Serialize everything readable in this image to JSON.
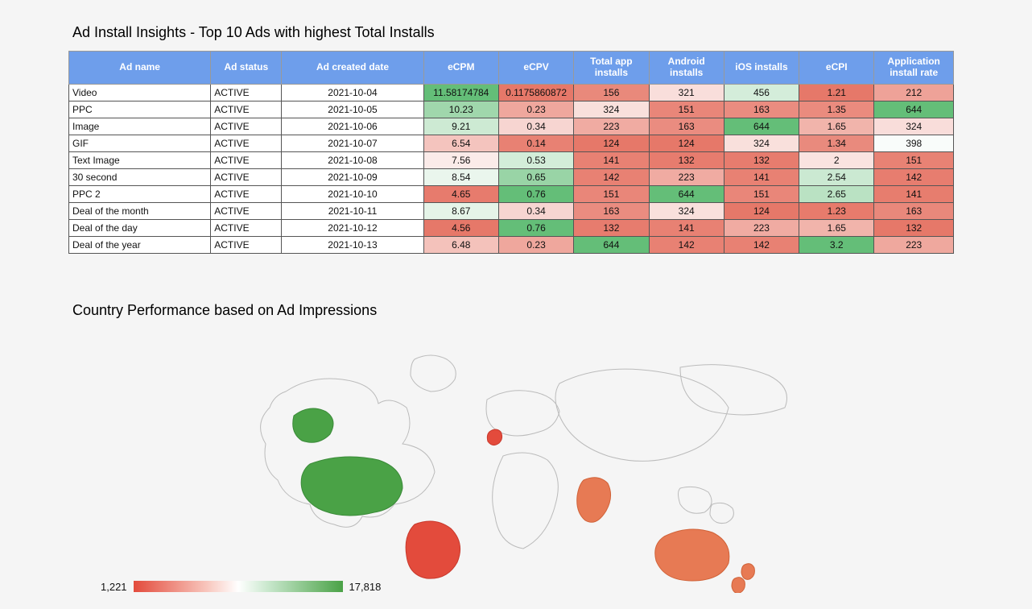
{
  "title1": "Ad Install Insights - Top 10 Ads with highest Total Installs",
  "title2": "Country Performance based on Ad Impressions",
  "legend_min": "1,221",
  "legend_max": "17,818",
  "heatmap_cols": [
    "ecpm",
    "ecpv",
    "total_app",
    "android",
    "ios",
    "ecpi",
    "air"
  ],
  "headers": {
    "name": "Ad name",
    "status": "Ad status",
    "date": "Ad created date",
    "ecpm": "eCPM",
    "ecpv": "eCPV",
    "total_app": "Total app installs",
    "android": "Android installs",
    "ios": "iOS installs",
    "ecpi": "eCPI",
    "air": "Application install rate"
  },
  "rows": [
    {
      "name": "Video",
      "status": "ACTIVE",
      "date": "2021-10-04",
      "ecpm": "11.58174784",
      "ecpv": "0.1175860872",
      "total_app": "156",
      "android": "321",
      "ios": "456",
      "ecpi": "1.21",
      "air": "212"
    },
    {
      "name": "PPC",
      "status": "ACTIVE",
      "date": "2021-10-05",
      "ecpm": "10.23",
      "ecpv": "0.23",
      "total_app": "324",
      "android": "151",
      "ios": "163",
      "ecpi": "1.35",
      "air": "644"
    },
    {
      "name": "Image",
      "status": "ACTIVE",
      "date": "2021-10-06",
      "ecpm": "9.21",
      "ecpv": "0.34",
      "total_app": "223",
      "android": "163",
      "ios": "644",
      "ecpi": "1.65",
      "air": "324"
    },
    {
      "name": "GIF",
      "status": "ACTIVE",
      "date": "2021-10-07",
      "ecpm": "6.54",
      "ecpv": "0.14",
      "total_app": "124",
      "android": "124",
      "ios": "324",
      "ecpi": "1.34",
      "air": "398"
    },
    {
      "name": "Text Image",
      "status": "ACTIVE",
      "date": "2021-10-08",
      "ecpm": "7.56",
      "ecpv": "0.53",
      "total_app": "141",
      "android": "132",
      "ios": "132",
      "ecpi": "2",
      "air": "151"
    },
    {
      "name": "30 second",
      "status": "ACTIVE",
      "date": "2021-10-09",
      "ecpm": "8.54",
      "ecpv": "0.65",
      "total_app": "142",
      "android": "223",
      "ios": "141",
      "ecpi": "2.54",
      "air": "142"
    },
    {
      "name": "PPC 2",
      "status": "ACTIVE",
      "date": "2021-10-10",
      "ecpm": "4.65",
      "ecpv": "0.76",
      "total_app": "151",
      "android": "644",
      "ios": "151",
      "ecpi": "2.65",
      "air": "141"
    },
    {
      "name": "Deal of the month",
      "status": "ACTIVE",
      "date": "2021-10-11",
      "ecpm": "8.67",
      "ecpv": "0.34",
      "total_app": "163",
      "android": "324",
      "ios": "124",
      "ecpi": "1.23",
      "air": "163"
    },
    {
      "name": "Deal of the day",
      "status": "ACTIVE",
      "date": "2021-10-12",
      "ecpm": "4.56",
      "ecpv": "0.76",
      "total_app": "132",
      "android": "141",
      "ios": "223",
      "ecpi": "1.65",
      "air": "132"
    },
    {
      "name": "Deal of the year",
      "status": "ACTIVE",
      "date": "2021-10-13",
      "ecpm": "6.48",
      "ecpv": "0.23",
      "total_app": "644",
      "android": "142",
      "ios": "142",
      "ecpi": "3.2",
      "air": "223"
    }
  ],
  "chart_data": {
    "type": "table",
    "title": "Ad Install Insights - Top 10 Ads with highest Total Installs",
    "columns": [
      "Ad name",
      "Ad status",
      "Ad created date",
      "eCPM",
      "eCPV",
      "Total app installs",
      "Android installs",
      "iOS installs",
      "eCPI",
      "Application install rate"
    ],
    "data": [
      [
        "Video",
        "ACTIVE",
        "2021-10-04",
        11.58174784,
        0.1175860872,
        156,
        321,
        456,
        1.21,
        212
      ],
      [
        "PPC",
        "ACTIVE",
        "2021-10-05",
        10.23,
        0.23,
        324,
        151,
        163,
        1.35,
        644
      ],
      [
        "Image",
        "ACTIVE",
        "2021-10-06",
        9.21,
        0.34,
        223,
        163,
        644,
        1.65,
        324
      ],
      [
        "GIF",
        "ACTIVE",
        "2021-10-07",
        6.54,
        0.14,
        124,
        124,
        324,
        1.34,
        398
      ],
      [
        "Text Image",
        "ACTIVE",
        "2021-10-08",
        7.56,
        0.53,
        141,
        132,
        132,
        2,
        151
      ],
      [
        "30 second",
        "ACTIVE",
        "2021-10-09",
        8.54,
        0.65,
        142,
        223,
        141,
        2.54,
        142
      ],
      [
        "PPC 2",
        "ACTIVE",
        "2021-10-10",
        4.65,
        0.76,
        151,
        644,
        151,
        2.65,
        141
      ],
      [
        "Deal of the month",
        "ACTIVE",
        "2021-10-11",
        8.67,
        0.34,
        163,
        324,
        124,
        1.23,
        163
      ],
      [
        "Deal of the day",
        "ACTIVE",
        "2021-10-12",
        4.56,
        0.76,
        132,
        141,
        223,
        1.65,
        132
      ],
      [
        "Deal of the year",
        "ACTIVE",
        "2021-10-13",
        6.48,
        0.23,
        644,
        142,
        142,
        3.2,
        223
      ]
    ],
    "map": {
      "title": "Country Performance based on Ad Impressions",
      "scale_min": 1221,
      "scale_max": 17818,
      "countries": [
        {
          "name": "United States",
          "approx_value": 17818
        },
        {
          "name": "Brazil",
          "approx_value": 2500
        },
        {
          "name": "United Kingdom",
          "approx_value": 1800
        },
        {
          "name": "India",
          "approx_value": 5000
        },
        {
          "name": "Australia",
          "approx_value": 5000
        },
        {
          "name": "New Zealand",
          "approx_value": 5000
        }
      ]
    }
  }
}
